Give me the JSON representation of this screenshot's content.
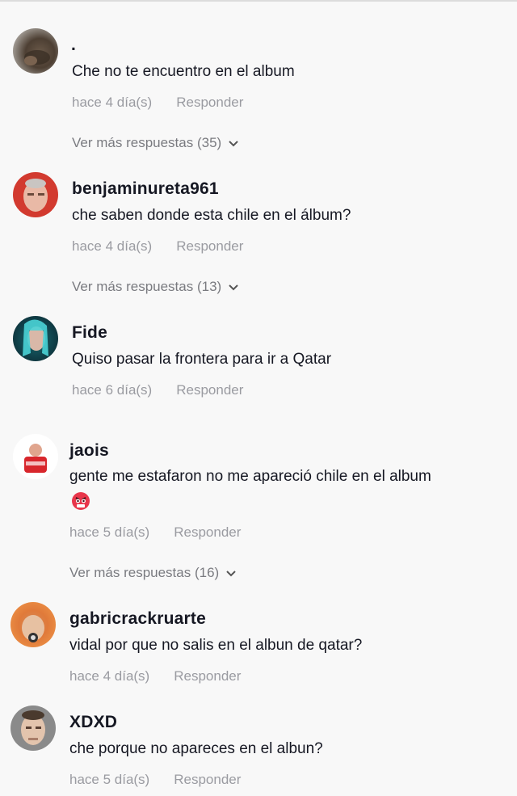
{
  "comments": [
    {
      "username": ".",
      "text": "Che no te encuentro en el album",
      "time": "hace 4 día(s)",
      "reply_label": "Responder",
      "more_replies": "Ver más respuestas (35)",
      "avatar_icon": "user-photo-avatar"
    },
    {
      "username": "benjaminureta961",
      "text": "che saben donde esta chile en el álbum?",
      "time": "hace 4 día(s)",
      "reply_label": "Responder",
      "more_replies": "Ver más respuestas (13)",
      "avatar_icon": "user-photo-avatar"
    },
    {
      "username": "Fide",
      "text": "Quiso pasar la frontera para ir a Qatar",
      "time": "hace 6 día(s)",
      "reply_label": "Responder",
      "avatar_icon": "user-photo-avatar"
    },
    {
      "username": "jaois",
      "text": "gente me estafaron no me apareció chile en el album",
      "emoji": "angry-face-emoji",
      "time": "hace 5 día(s)",
      "reply_label": "Responder",
      "more_replies": "Ver más respuestas (16)",
      "avatar_icon": "user-photo-avatar"
    },
    {
      "username": "gabricrackruarte",
      "text": "vidal por que no salis en el albun de qatar?",
      "time": "hace 4 día(s)",
      "reply_label": "Responder",
      "avatar_icon": "user-photo-avatar"
    },
    {
      "username": "XDXD",
      "text": "che porque no apareces en el albun?",
      "time": "hace 5 día(s)",
      "reply_label": "Responder",
      "avatar_icon": "user-photo-avatar"
    }
  ],
  "colors": {
    "background": "#f8f8f8",
    "text": "#161823",
    "meta": "#9a9ba1",
    "more": "#7a7b80"
  }
}
